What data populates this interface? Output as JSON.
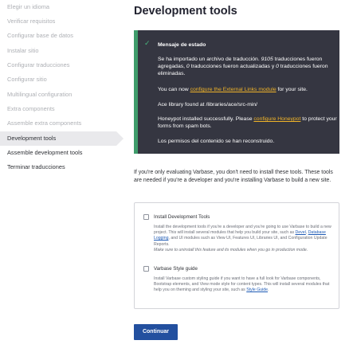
{
  "sidebar": {
    "steps": [
      {
        "label": "Elegir un idioma",
        "state": "done"
      },
      {
        "label": "Verificar requisitos",
        "state": "done"
      },
      {
        "label": "Configurar base de datos",
        "state": "done"
      },
      {
        "label": "Instalar sitio",
        "state": "done"
      },
      {
        "label": "Configurar traducciones",
        "state": "done"
      },
      {
        "label": "Configurar sitio",
        "state": "done"
      },
      {
        "label": "Multilingual configuration",
        "state": "done"
      },
      {
        "label": "Extra components",
        "state": "done"
      },
      {
        "label": "Assemble extra components",
        "state": "done"
      },
      {
        "label": "Development tools",
        "state": "current"
      },
      {
        "label": "Assemble development tools",
        "state": "todo"
      },
      {
        "label": "Terminar traducciones",
        "state": "todo"
      }
    ]
  },
  "page": {
    "title": "Development tools"
  },
  "status": {
    "title": "Mensaje de estado",
    "msg1_a": "Se ha importado un archivo de traducción. ",
    "msg1_n1": "9105",
    "msg1_b": " traducciones fueron agregadas, ",
    "msg1_n2": "0",
    "msg1_c": " traducciones fueron actualizadas y ",
    "msg1_n3": "0",
    "msg1_d": " traducciones fueron eliminadas.",
    "msg2_a": "You can now ",
    "msg2_link": "configure the External Links module",
    "msg2_b": " for your site.",
    "msg3": "Ace library found at /libraries/ace/src-min/",
    "msg4_a": "Honeypot installed successfully. Please ",
    "msg4_link": "configure Honeypot",
    "msg4_b": " to protect your forms from spam bots.",
    "msg5": "Los permisos del contenido se han reconstruido.",
    "accent": "#3f9c6b",
    "link_color": "#f0b429"
  },
  "intro": "If you're only evaluating Varbase, you don't need to install these tools. These tools are needed if you're a developer and you're installing Varbase to build a new site.",
  "options": {
    "dev": {
      "label": "Install Development Tools",
      "checked": false,
      "desc_a": "Install the development tools if you're a developer and you're going to use Varbase to build a new project. This will install several modules that help you build your site, such as ",
      "link1": "Devel",
      "sep1": ", ",
      "link2": "Database Logging",
      "desc_b": ", and UI modules such as View UI, Features UI, Libraries UI, and Configuration Update Reports.",
      "note": "Make sure to uninstall this feature and its modules when you go in production mode."
    },
    "style": {
      "label": "Varbase Style guide",
      "checked": false,
      "desc_a": "Install Varbase custom styling guide if you want to have a full look for Varbase components, Bootstrap elements, and View mode style for content types. This will install several modules that help you on theming and styling your site, such as ",
      "link": "Style Guide",
      "desc_b": "."
    }
  },
  "actions": {
    "continue": "Continuar",
    "primary_color": "#23509f"
  }
}
